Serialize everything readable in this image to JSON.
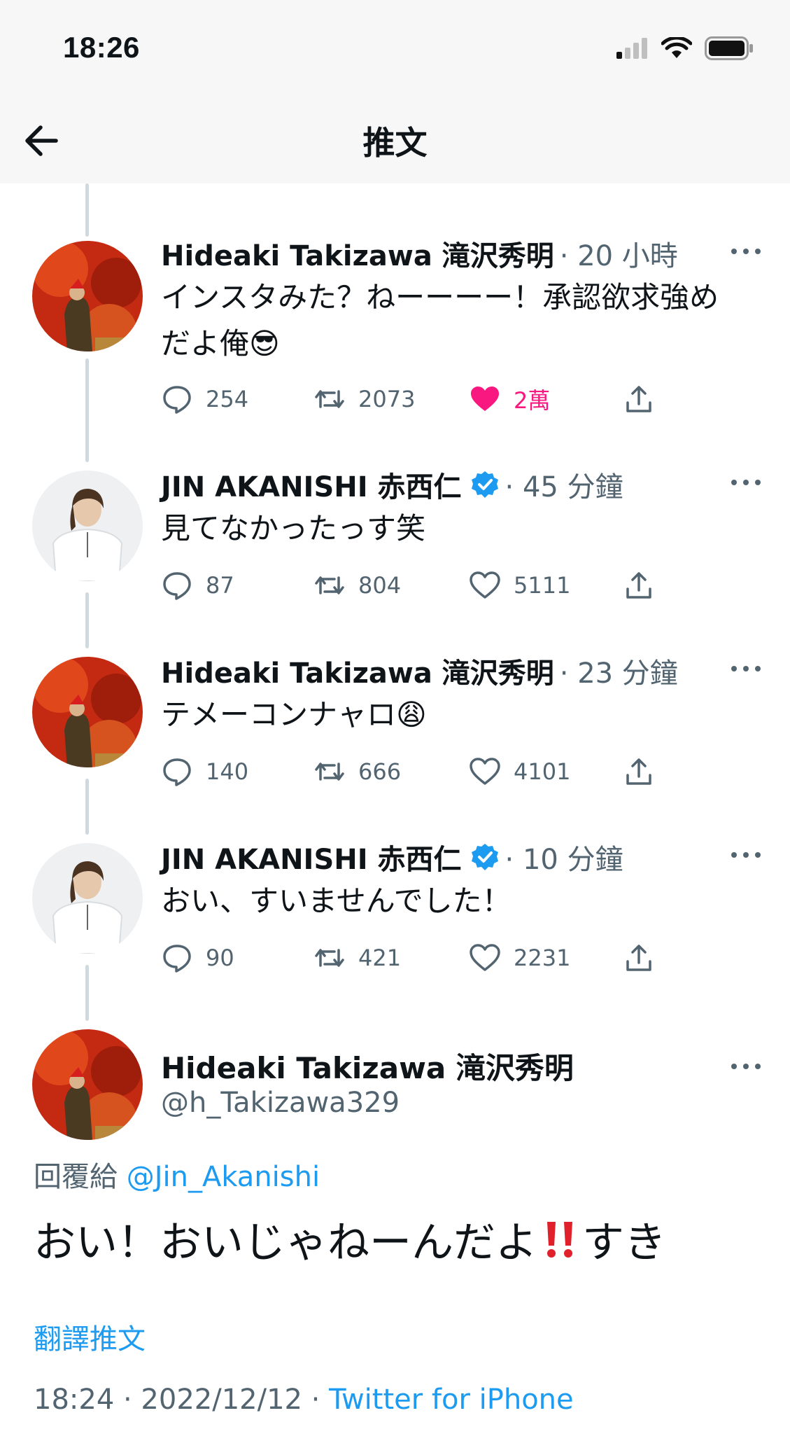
{
  "status_bar": {
    "time": "18:26"
  },
  "header": {
    "title": "推文"
  },
  "thread": [
    {
      "author": "Hideaki Takizawa 滝沢秀明",
      "verified": false,
      "meta": "· 20 小時",
      "text": "インスタみた？ねーーーー！承認欲求強めだよ俺😎",
      "replies": "254",
      "retweets": "2073",
      "likes": "2萬",
      "liked": true
    },
    {
      "author": "JIN AKANISHI 赤西仁",
      "verified": true,
      "meta": "· 45 分鐘",
      "text": "見てなかったっす笑",
      "replies": "87",
      "retweets": "804",
      "likes": "5111",
      "liked": false
    },
    {
      "author": "Hideaki Takizawa 滝沢秀明",
      "verified": false,
      "meta": "· 23 分鐘",
      "text": "テメーコンナャロ😩",
      "replies": "140",
      "retweets": "666",
      "likes": "4101",
      "liked": false
    },
    {
      "author": "JIN AKANISHI 赤西仁",
      "verified": true,
      "meta": "· 10 分鐘",
      "text": "おい、すいませんでした！",
      "replies": "90",
      "retweets": "421",
      "likes": "2231",
      "liked": false
    }
  ],
  "main_tweet": {
    "author": "Hideaki Takizawa 滝沢秀明",
    "handle": "@h_Takizawa329",
    "reply_prefix": "回覆給",
    "reply_to": "@Jin_Akanishi",
    "text_before": "おい！おいじゃねーんだよ",
    "text_after": "すき",
    "translate": "翻譯推文",
    "timestamp": "18:24 · 2022/12/12 ·",
    "source": "Twitter for iPhone"
  },
  "colors": {
    "accent": "#1d9bf0",
    "like": "#f91880",
    "secondary_text": "#536471",
    "thread_line": "#cfd9de"
  },
  "icons": {
    "back": "arrow-left-icon",
    "reply": "speech-bubble-icon",
    "retweet": "retweet-icon",
    "like": "heart-icon",
    "share": "share-icon",
    "more": "more-dots-icon",
    "verified": "verified-badge-icon"
  }
}
